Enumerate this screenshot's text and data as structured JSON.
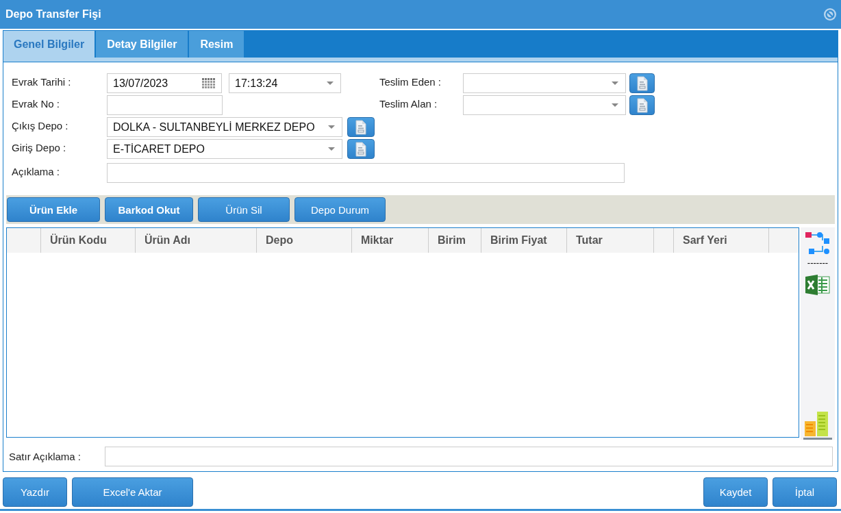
{
  "window": {
    "title": "Depo Transfer Fişi"
  },
  "tabs": [
    {
      "label": "Genel Bilgiler",
      "selected": true
    },
    {
      "label": "Detay Bilgiler",
      "selected": false
    },
    {
      "label": "Resim",
      "selected": false
    }
  ],
  "form": {
    "left": [
      {
        "label": "Evrak Tarihi :",
        "kind": "datetime",
        "date": "13/07/2023",
        "time": "17:13:24"
      },
      {
        "label": "Evrak No :",
        "kind": "text"
      },
      {
        "label": "Çıkış Depo :",
        "kind": "select",
        "value": "DOLKA - SULTANBEYLİ MERKEZ DEPO",
        "lookup": true
      },
      {
        "label": "Giriş Depo :",
        "kind": "select",
        "value": "E-TİCARET DEPO",
        "lookup": true
      },
      {
        "label": "Açıklama :",
        "kind": "wide-text"
      }
    ],
    "right": [
      {
        "label": "Teslim Eden :",
        "kind": "select",
        "lookup": true
      },
      {
        "label": "Teslim Alan :",
        "kind": "select",
        "lookup": true
      }
    ]
  },
  "toolbar": {
    "buttons": [
      {
        "label": "Ürün Ekle",
        "bold": true
      },
      {
        "label": "Barkod Okut",
        "bold": true
      },
      {
        "label": "Ürün Sil",
        "bold": false
      },
      {
        "label": "Depo Durum",
        "bold": false
      }
    ]
  },
  "table": {
    "columns": [
      "Ürün Kodu",
      "Ürün Adı",
      "Depo",
      "Miktar",
      "Birim",
      "Birim Fiyat",
      "Tutar",
      "Sarf Yeri"
    ]
  },
  "side_tools": {
    "separator": "-------"
  },
  "line_note": {
    "label": "Satır Açıklama :"
  },
  "footer": {
    "left_buttons": [
      "Yazdır",
      "Excel'e Aktar"
    ],
    "right_buttons": [
      "Kaydet",
      "İptal"
    ]
  }
}
